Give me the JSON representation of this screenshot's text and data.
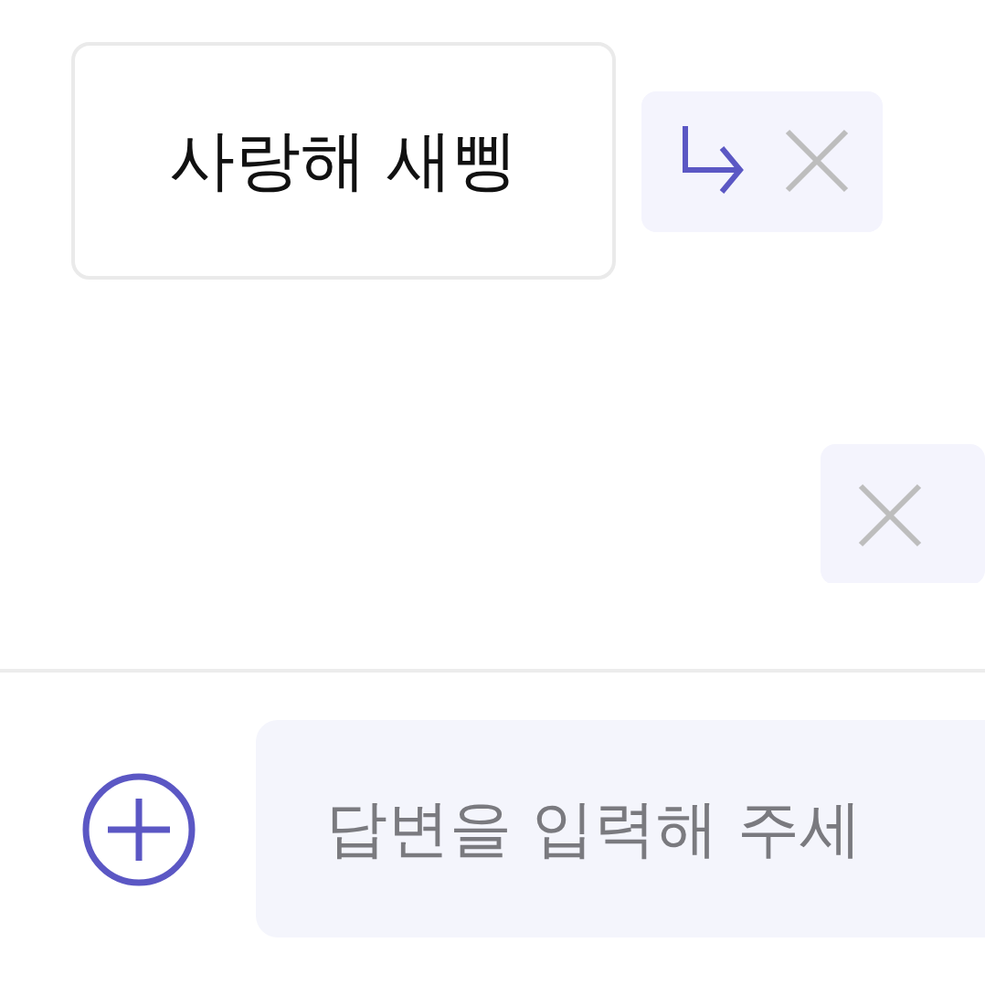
{
  "messages": [
    {
      "text": "사랑해 새삥",
      "actions": [
        {
          "kind": "reply"
        },
        {
          "kind": "delete"
        }
      ]
    },
    {
      "actions": [
        {
          "kind": "delete"
        }
      ]
    }
  ],
  "composer": {
    "placeholder": "답변을 입력해 주세"
  }
}
